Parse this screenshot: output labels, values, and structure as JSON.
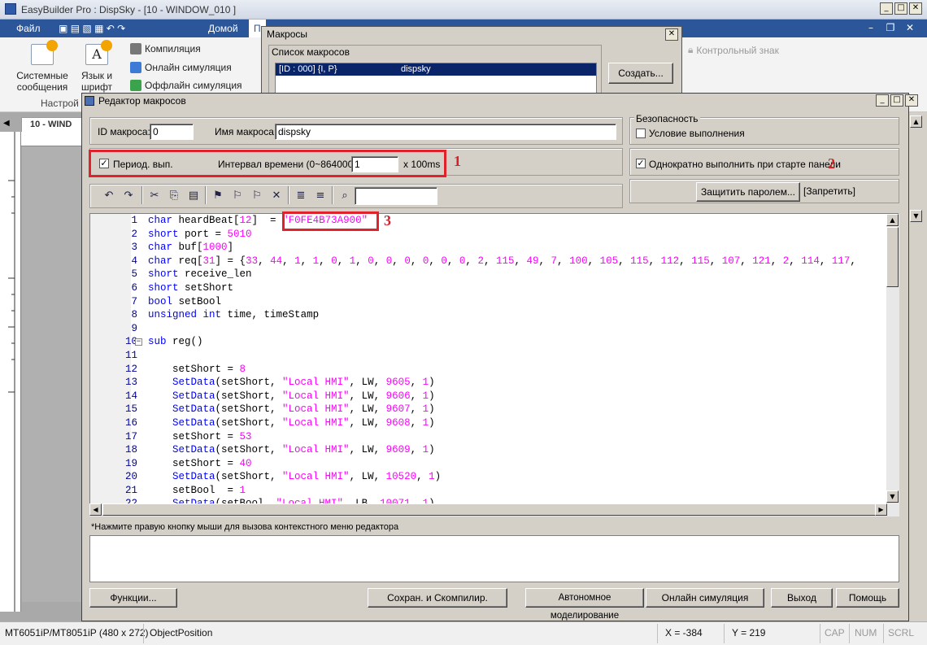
{
  "app": {
    "title": "EasyBuilder Pro : DispSky - [10 - WINDOW_010 ]",
    "window_controls": [
      "_",
      "□",
      "✕"
    ]
  },
  "ribbon": {
    "file_tab": "Файл",
    "home_tab": "Домой",
    "next_tab_partial": "П",
    "buttons_big": [
      "Системные сообщения",
      "Язык и шрифт"
    ],
    "sys_msg_line1": "Системные",
    "sys_msg_line2": "сообщения",
    "lang_line1": "Язык и",
    "lang_line2": "шрифт",
    "buttons_small": [
      "Компиляция",
      "Онлайн симуляция",
      "Оффлайн симуляция"
    ],
    "group_label": "Настрой",
    "right_item": "Контрольный знак"
  },
  "document": {
    "tab_label": "10 - WIND"
  },
  "macros_dialog": {
    "title": "Макросы",
    "group_label": "Список макросов",
    "list_items": [
      {
        "id": "[ID : 000] {I, P}",
        "name": "dispsky"
      }
    ],
    "create_button": "Создать..."
  },
  "editor": {
    "title": "Редактор макросов",
    "macro_id_label": "ID макроса:",
    "macro_id_value": "0",
    "macro_name_label": "Имя макроса:",
    "macro_name_value": "dispsky",
    "security_label": "Безопасность",
    "condition_label": "Условие выполнения",
    "periodic_label": "Период. вып.",
    "periodic_checked": true,
    "interval_label": "Интервал времени (0~864000) :",
    "interval_value": "1",
    "interval_unit": "x 100ms",
    "run_once_label": "Однократно выполнить при старте панели",
    "run_once_checked": true,
    "protect_button": "Защитить паролем...",
    "forbid_label": "[Запретить]",
    "hint": "*Нажмите правую кнопку мыши для вызова контекстного меню редактора",
    "markers": [
      "1",
      "2",
      "3"
    ],
    "buttons": {
      "functions": "Функции...",
      "save_compile": "Сохран. и Скомпилир.",
      "offline_sim": "Автономное моделирование",
      "online_sim": "Онлайн симуляция",
      "exit": "Выход",
      "help": "Помощь"
    },
    "code_lines": [
      {
        "n": "1",
        "tokens": [
          [
            "kw",
            "char"
          ],
          [
            "t",
            " heardBeat["
          ],
          [
            "num",
            "12"
          ],
          [
            "t",
            "]  = "
          ],
          [
            "str",
            "\"F0FE4B73A900\""
          ]
        ]
      },
      {
        "n": "2",
        "tokens": [
          [
            "kw",
            "short"
          ],
          [
            "t",
            " port = "
          ],
          [
            "num",
            "5010"
          ]
        ]
      },
      {
        "n": "3",
        "tokens": [
          [
            "kw",
            "char"
          ],
          [
            "t",
            " buf["
          ],
          [
            "num",
            "1000"
          ],
          [
            "t",
            "]"
          ]
        ]
      },
      {
        "n": "4",
        "tokens": [
          [
            "kw",
            "char"
          ],
          [
            "t",
            " req["
          ],
          [
            "num",
            "31"
          ],
          [
            "t",
            "] = {"
          ],
          [
            "num",
            "33"
          ],
          [
            "t",
            ", "
          ],
          [
            "num",
            "44"
          ],
          [
            "t",
            ", "
          ],
          [
            "num",
            "1"
          ],
          [
            "t",
            ", "
          ],
          [
            "num",
            "1"
          ],
          [
            "t",
            ", "
          ],
          [
            "num",
            "0"
          ],
          [
            "t",
            ", "
          ],
          [
            "num",
            "1"
          ],
          [
            "t",
            ", "
          ],
          [
            "num",
            "0"
          ],
          [
            "t",
            ", "
          ],
          [
            "num",
            "0"
          ],
          [
            "t",
            ", "
          ],
          [
            "num",
            "0"
          ],
          [
            "t",
            ", "
          ],
          [
            "num",
            "0"
          ],
          [
            "t",
            ", "
          ],
          [
            "num",
            "0"
          ],
          [
            "t",
            ", "
          ],
          [
            "num",
            "0"
          ],
          [
            "t",
            ", "
          ],
          [
            "num",
            "2"
          ],
          [
            "t",
            ", "
          ],
          [
            "num",
            "115"
          ],
          [
            "t",
            ", "
          ],
          [
            "num",
            "49"
          ],
          [
            "t",
            ", "
          ],
          [
            "num",
            "7"
          ],
          [
            "t",
            ", "
          ],
          [
            "num",
            "100"
          ],
          [
            "t",
            ", "
          ],
          [
            "num",
            "105"
          ],
          [
            "t",
            ", "
          ],
          [
            "num",
            "115"
          ],
          [
            "t",
            ", "
          ],
          [
            "num",
            "112"
          ],
          [
            "t",
            ", "
          ],
          [
            "num",
            "115"
          ],
          [
            "t",
            ", "
          ],
          [
            "num",
            "107"
          ],
          [
            "t",
            ", "
          ],
          [
            "num",
            "121"
          ],
          [
            "t",
            ", "
          ],
          [
            "num",
            "2"
          ],
          [
            "t",
            ", "
          ],
          [
            "num",
            "114"
          ],
          [
            "t",
            ", "
          ],
          [
            "num",
            "117"
          ],
          [
            "t",
            ","
          ]
        ]
      },
      {
        "n": "5",
        "tokens": [
          [
            "kw",
            "short"
          ],
          [
            "t",
            " receive_len"
          ]
        ]
      },
      {
        "n": "6",
        "tokens": [
          [
            "kw",
            "short"
          ],
          [
            "t",
            " setShort"
          ]
        ]
      },
      {
        "n": "7",
        "tokens": [
          [
            "kw",
            "bool"
          ],
          [
            "t",
            " setBool"
          ]
        ]
      },
      {
        "n": "8",
        "tokens": [
          [
            "kw",
            "unsigned"
          ],
          [
            "t",
            " "
          ],
          [
            "kw",
            "int"
          ],
          [
            "t",
            " time, timeStamp"
          ]
        ]
      },
      {
        "n": "9",
        "tokens": []
      },
      {
        "n": "10",
        "tokens": [
          [
            "kw",
            "sub"
          ],
          [
            "t",
            " reg()"
          ]
        ]
      },
      {
        "n": "11",
        "tokens": []
      },
      {
        "n": "12",
        "tokens": [
          [
            "t",
            "    setShort = "
          ],
          [
            "num",
            "8"
          ]
        ]
      },
      {
        "n": "13",
        "tokens": [
          [
            "t",
            "    "
          ],
          [
            "fn",
            "SetData"
          ],
          [
            "t",
            "(setShort, "
          ],
          [
            "str",
            "\"Local HMI\""
          ],
          [
            "t",
            ", LW, "
          ],
          [
            "num",
            "9605"
          ],
          [
            "t",
            ", "
          ],
          [
            "num",
            "1"
          ],
          [
            "t",
            ")"
          ]
        ]
      },
      {
        "n": "14",
        "tokens": [
          [
            "t",
            "    "
          ],
          [
            "fn",
            "SetData"
          ],
          [
            "t",
            "(setShort, "
          ],
          [
            "str",
            "\"Local HMI\""
          ],
          [
            "t",
            ", LW, "
          ],
          [
            "num",
            "9606"
          ],
          [
            "t",
            ", "
          ],
          [
            "num",
            "1"
          ],
          [
            "t",
            ")"
          ]
        ]
      },
      {
        "n": "15",
        "tokens": [
          [
            "t",
            "    "
          ],
          [
            "fn",
            "SetData"
          ],
          [
            "t",
            "(setShort, "
          ],
          [
            "str",
            "\"Local HMI\""
          ],
          [
            "t",
            ", LW, "
          ],
          [
            "num",
            "9607"
          ],
          [
            "t",
            ", "
          ],
          [
            "num",
            "1"
          ],
          [
            "t",
            ")"
          ]
        ]
      },
      {
        "n": "16",
        "tokens": [
          [
            "t",
            "    "
          ],
          [
            "fn",
            "SetData"
          ],
          [
            "t",
            "(setShort, "
          ],
          [
            "str",
            "\"Local HMI\""
          ],
          [
            "t",
            ", LW, "
          ],
          [
            "num",
            "9608"
          ],
          [
            "t",
            ", "
          ],
          [
            "num",
            "1"
          ],
          [
            "t",
            ")"
          ]
        ]
      },
      {
        "n": "17",
        "tokens": [
          [
            "t",
            "    setShort = "
          ],
          [
            "num",
            "53"
          ]
        ]
      },
      {
        "n": "18",
        "tokens": [
          [
            "t",
            "    "
          ],
          [
            "fn",
            "SetData"
          ],
          [
            "t",
            "(setShort, "
          ],
          [
            "str",
            "\"Local HMI\""
          ],
          [
            "t",
            ", LW, "
          ],
          [
            "num",
            "9609"
          ],
          [
            "t",
            ", "
          ],
          [
            "num",
            "1"
          ],
          [
            "t",
            ")"
          ]
        ]
      },
      {
        "n": "19",
        "tokens": [
          [
            "t",
            "    setShort = "
          ],
          [
            "num",
            "40"
          ]
        ]
      },
      {
        "n": "20",
        "tokens": [
          [
            "t",
            "    "
          ],
          [
            "fn",
            "SetData"
          ],
          [
            "t",
            "(setShort, "
          ],
          [
            "str",
            "\"Local HMI\""
          ],
          [
            "t",
            ", LW, "
          ],
          [
            "num",
            "10520"
          ],
          [
            "t",
            ", "
          ],
          [
            "num",
            "1"
          ],
          [
            "t",
            ")"
          ]
        ]
      },
      {
        "n": "21",
        "tokens": [
          [
            "t",
            "    setBool  = "
          ],
          [
            "num",
            "1"
          ]
        ]
      },
      {
        "n": "22",
        "tokens": [
          [
            "t",
            "    "
          ],
          [
            "fn",
            "SetData"
          ],
          [
            "t",
            "(setBool, "
          ],
          [
            "str",
            "\"Local HMI\""
          ],
          [
            "t",
            ", LB, "
          ],
          [
            "num",
            "10071"
          ],
          [
            "t",
            ", "
          ],
          [
            "num",
            "1"
          ],
          [
            "t",
            ")"
          ]
        ]
      }
    ]
  },
  "statusbar": {
    "model": "MT6051iP/MT8051iP (480 x 272)",
    "object": "ObjectPosition",
    "x": "X = -384",
    "y": "Y = 219",
    "cap": "CAP",
    "num": "NUM",
    "scrl": "SCRL"
  },
  "colors": {
    "ribbon_blue": "#2b579a",
    "highlight": "#e0232b",
    "keyword": "#0000ff",
    "literal": "#ff00ff",
    "selection": "#0a246a"
  }
}
